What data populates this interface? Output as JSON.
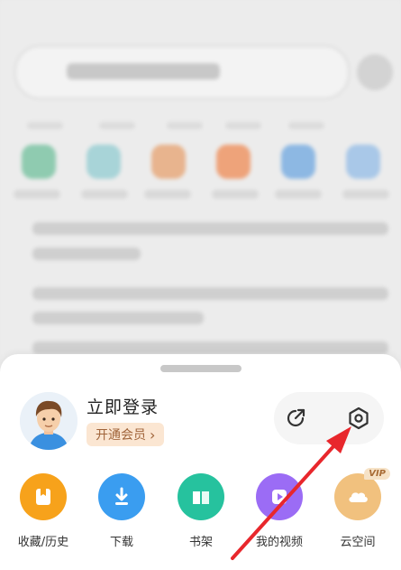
{
  "sheet": {
    "login_text": "立即登录",
    "vip_button": "开通会员",
    "vip_chevron": "›",
    "items": [
      {
        "label": "收藏/历史",
        "icon": "bookmark-icon",
        "color": "#f7a21b"
      },
      {
        "label": "下载",
        "icon": "download-icon",
        "color": "#3a9df0"
      },
      {
        "label": "书架",
        "icon": "book-icon",
        "color": "#26c29e"
      },
      {
        "label": "我的视频",
        "icon": "video-icon",
        "color": "#9b6cf5"
      },
      {
        "label": "云空间",
        "icon": "cloud-icon",
        "color": "#f1c17e",
        "badge": "VIP"
      }
    ],
    "utility_icons": [
      "share-icon",
      "settings-icon"
    ]
  },
  "colors": {
    "accent_arrow": "#e8272c",
    "vip_text": "#a0643a",
    "vip_bg": "#fbe6d2"
  }
}
